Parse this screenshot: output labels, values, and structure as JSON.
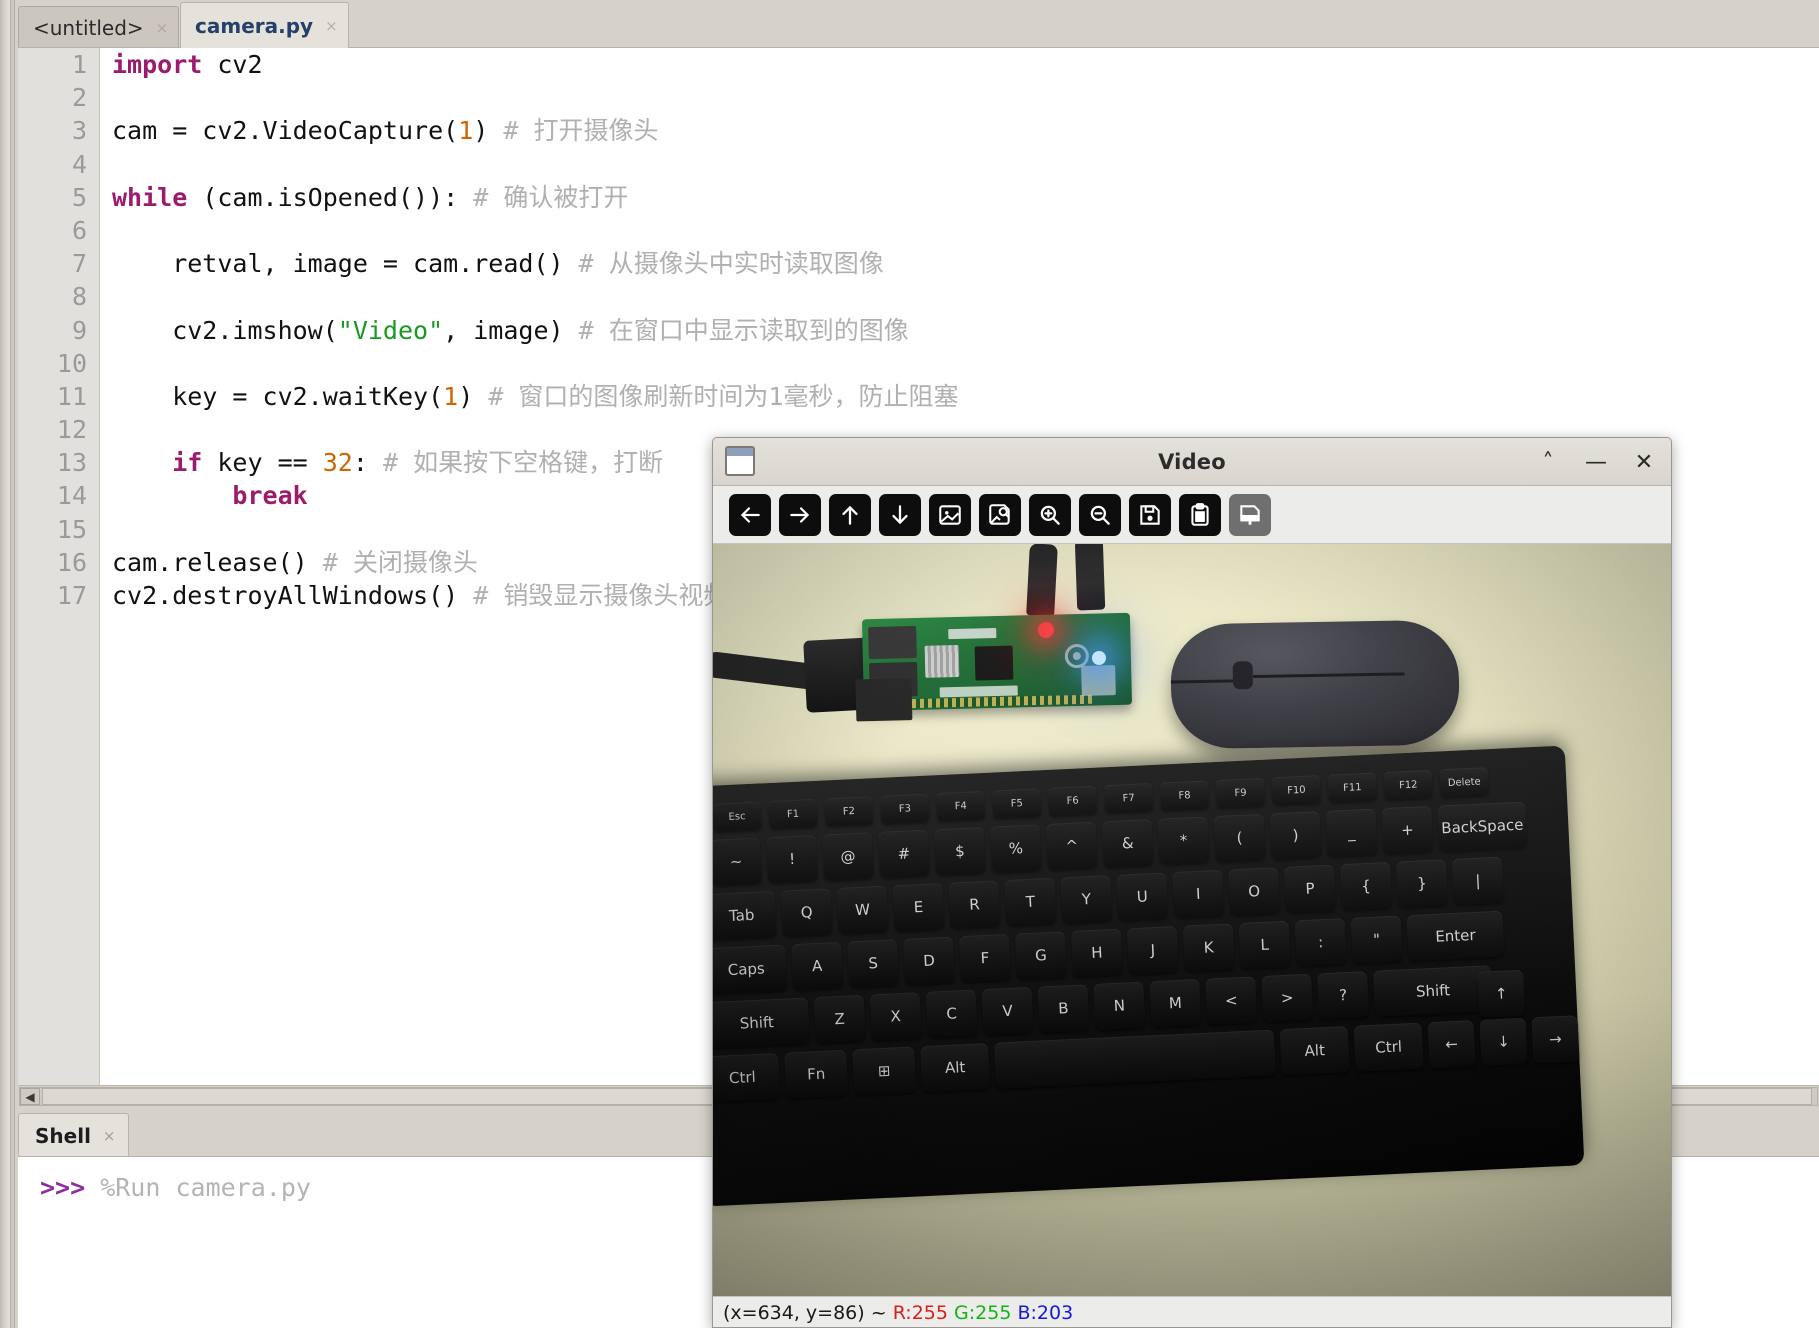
{
  "editor": {
    "tabs": [
      {
        "label": "<untitled>",
        "close": "×",
        "active": false
      },
      {
        "label": "camera.py",
        "close": "×",
        "active": true
      }
    ],
    "line_numbers": [
      "1",
      "2",
      "3",
      "4",
      "5",
      "6",
      "7",
      "8",
      "9",
      "10",
      "11",
      "12",
      "13",
      "14",
      "15",
      "16",
      "17"
    ],
    "code_lines": [
      {
        "n": 1,
        "tokens": [
          {
            "t": "kw",
            "v": "import"
          },
          {
            "t": "plain",
            "v": " cv2"
          }
        ]
      },
      {
        "n": 2,
        "tokens": []
      },
      {
        "n": 3,
        "tokens": [
          {
            "t": "plain",
            "v": "cam = cv2.VideoCapture("
          },
          {
            "t": "num",
            "v": "1"
          },
          {
            "t": "plain",
            "v": ") "
          },
          {
            "t": "cmt",
            "v": "# 打开摄像头"
          }
        ]
      },
      {
        "n": 4,
        "tokens": []
      },
      {
        "n": 5,
        "tokens": [
          {
            "t": "kw",
            "v": "while"
          },
          {
            "t": "plain",
            "v": " (cam.isOpened()): "
          },
          {
            "t": "cmt",
            "v": "# 确认被打开"
          }
        ]
      },
      {
        "n": 6,
        "tokens": []
      },
      {
        "n": 7,
        "tokens": [
          {
            "t": "plain",
            "v": "    retval, image = cam.read() "
          },
          {
            "t": "cmt",
            "v": "# 从摄像头中实时读取图像"
          }
        ]
      },
      {
        "n": 8,
        "tokens": []
      },
      {
        "n": 9,
        "tokens": [
          {
            "t": "plain",
            "v": "    cv2.imshow("
          },
          {
            "t": "str",
            "v": "\"Video\""
          },
          {
            "t": "plain",
            "v": ", image) "
          },
          {
            "t": "cmt",
            "v": "# 在窗口中显示读取到的图像"
          }
        ]
      },
      {
        "n": 10,
        "tokens": []
      },
      {
        "n": 11,
        "tokens": [
          {
            "t": "plain",
            "v": "    key = cv2.waitKey("
          },
          {
            "t": "num",
            "v": "1"
          },
          {
            "t": "plain",
            "v": ") "
          },
          {
            "t": "cmt",
            "v": "# 窗口的图像刷新时间为1毫秒，防止阻塞"
          }
        ]
      },
      {
        "n": 12,
        "tokens": []
      },
      {
        "n": 13,
        "tokens": [
          {
            "t": "plain",
            "v": "    "
          },
          {
            "t": "kw",
            "v": "if"
          },
          {
            "t": "plain",
            "v": " key == "
          },
          {
            "t": "num",
            "v": "32"
          },
          {
            "t": "plain",
            "v": ": "
          },
          {
            "t": "cmt",
            "v": "# 如果按下空格键，打断"
          }
        ]
      },
      {
        "n": 14,
        "tokens": [
          {
            "t": "plain",
            "v": "        "
          },
          {
            "t": "kw",
            "v": "break"
          }
        ]
      },
      {
        "n": 15,
        "tokens": []
      },
      {
        "n": 16,
        "tokens": [
          {
            "t": "plain",
            "v": "cam.release() "
          },
          {
            "t": "cmt",
            "v": "# 关闭摄像头"
          }
        ]
      },
      {
        "n": 17,
        "tokens": [
          {
            "t": "plain",
            "v": "cv2.destroyAllWindows() "
          },
          {
            "t": "cmt",
            "v": "# 销毁显示摄像头视频的窗口"
          }
        ]
      }
    ],
    "scrollbar": {
      "left_arrow": "◀"
    }
  },
  "shell": {
    "tab_label": "Shell",
    "tab_close": "×",
    "prompt": ">>>",
    "command": " %Run camera.py"
  },
  "video_window": {
    "title": "Video",
    "app_icon": "window-icon",
    "window_buttons": [
      {
        "name": "rollup-button",
        "glyph": "˄"
      },
      {
        "name": "minimize-button",
        "glyph": "—"
      },
      {
        "name": "close-button",
        "glyph": "✕"
      }
    ],
    "toolbar": [
      {
        "name": "pan-left-icon",
        "label": "left-arrow",
        "state": "normal"
      },
      {
        "name": "pan-right-icon",
        "label": "right-arrow",
        "state": "normal"
      },
      {
        "name": "pan-up-icon",
        "label": "up-arrow",
        "state": "normal"
      },
      {
        "name": "pan-down-icon",
        "label": "down-arrow",
        "state": "normal"
      },
      {
        "name": "fit-image-icon",
        "label": "image",
        "state": "normal"
      },
      {
        "name": "zoom-fit-icon",
        "label": "image-zoom",
        "state": "normal"
      },
      {
        "name": "zoom-in-icon",
        "label": "magnifier-plus",
        "state": "normal"
      },
      {
        "name": "zoom-out-icon",
        "label": "magnifier-minus",
        "state": "normal"
      },
      {
        "name": "save-icon",
        "label": "floppy-disk",
        "state": "normal"
      },
      {
        "name": "copy-icon",
        "label": "clipboard",
        "state": "normal"
      },
      {
        "name": "properties-icon",
        "label": "paintbrush",
        "state": "active"
      }
    ],
    "status": {
      "coords": "(x=634, y=86) ~ ",
      "r": "R:255",
      "g": "G:255",
      "b": "B:203",
      "space1": " ",
      "space2": " "
    },
    "scene_description": "raspberry-pi-board-keyboard-mouse-webcam-frame"
  },
  "colors": {
    "keyword": "#9b1c6e",
    "number": "#cc6600",
    "string": "#1a9a25",
    "comment": "#b0b0b0",
    "prompt": "#8e2fa0",
    "status_r": "#d81f1f",
    "status_g": "#12b512",
    "status_b": "#1717e0",
    "window_chrome": "#dedbd5",
    "desk": "#e9e7c2"
  }
}
